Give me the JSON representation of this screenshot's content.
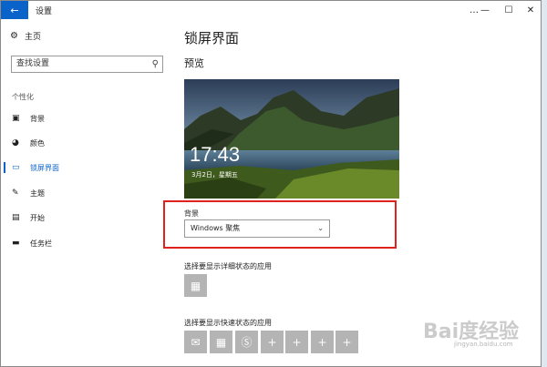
{
  "window": {
    "title": "设置",
    "back_icon": "back-arrow-icon",
    "controls": [
      "…",
      "—",
      "☐",
      "✕"
    ]
  },
  "sidebar": {
    "home_label": "主页",
    "search_placeholder": "查找设置",
    "section_label": "个性化",
    "items": [
      {
        "label": "背景",
        "icon": "image-icon",
        "active": false
      },
      {
        "label": "颜色",
        "icon": "palette-icon",
        "active": false
      },
      {
        "label": "锁屏界面",
        "icon": "lock-screen-icon",
        "active": true
      },
      {
        "label": "主题",
        "icon": "brush-icon",
        "active": false
      },
      {
        "label": "开始",
        "icon": "start-icon",
        "active": false
      },
      {
        "label": "任务栏",
        "icon": "taskbar-icon",
        "active": false
      }
    ]
  },
  "main": {
    "page_title": "锁屏界面",
    "preview_label": "预览",
    "preview": {
      "time": "17:43",
      "date": "3月2日，星期五"
    },
    "background_label": "背景",
    "background_value": "Windows 聚焦",
    "detail_status_label": "选择要显示详细状态的应用",
    "quick_status_label": "选择要显示快速状态的应用",
    "quick_tiles": [
      "mail-icon",
      "calendar-icon",
      "skype-icon",
      "plus-icon",
      "plus-icon",
      "plus-icon",
      "plus-icon"
    ]
  },
  "watermark": {
    "text": "Bai度经验",
    "sub": "jingyan.baidu.com"
  },
  "colors": {
    "accent": "#0b63c5",
    "highlight_box": "#e0221e",
    "tile": "#b4b4b4"
  }
}
